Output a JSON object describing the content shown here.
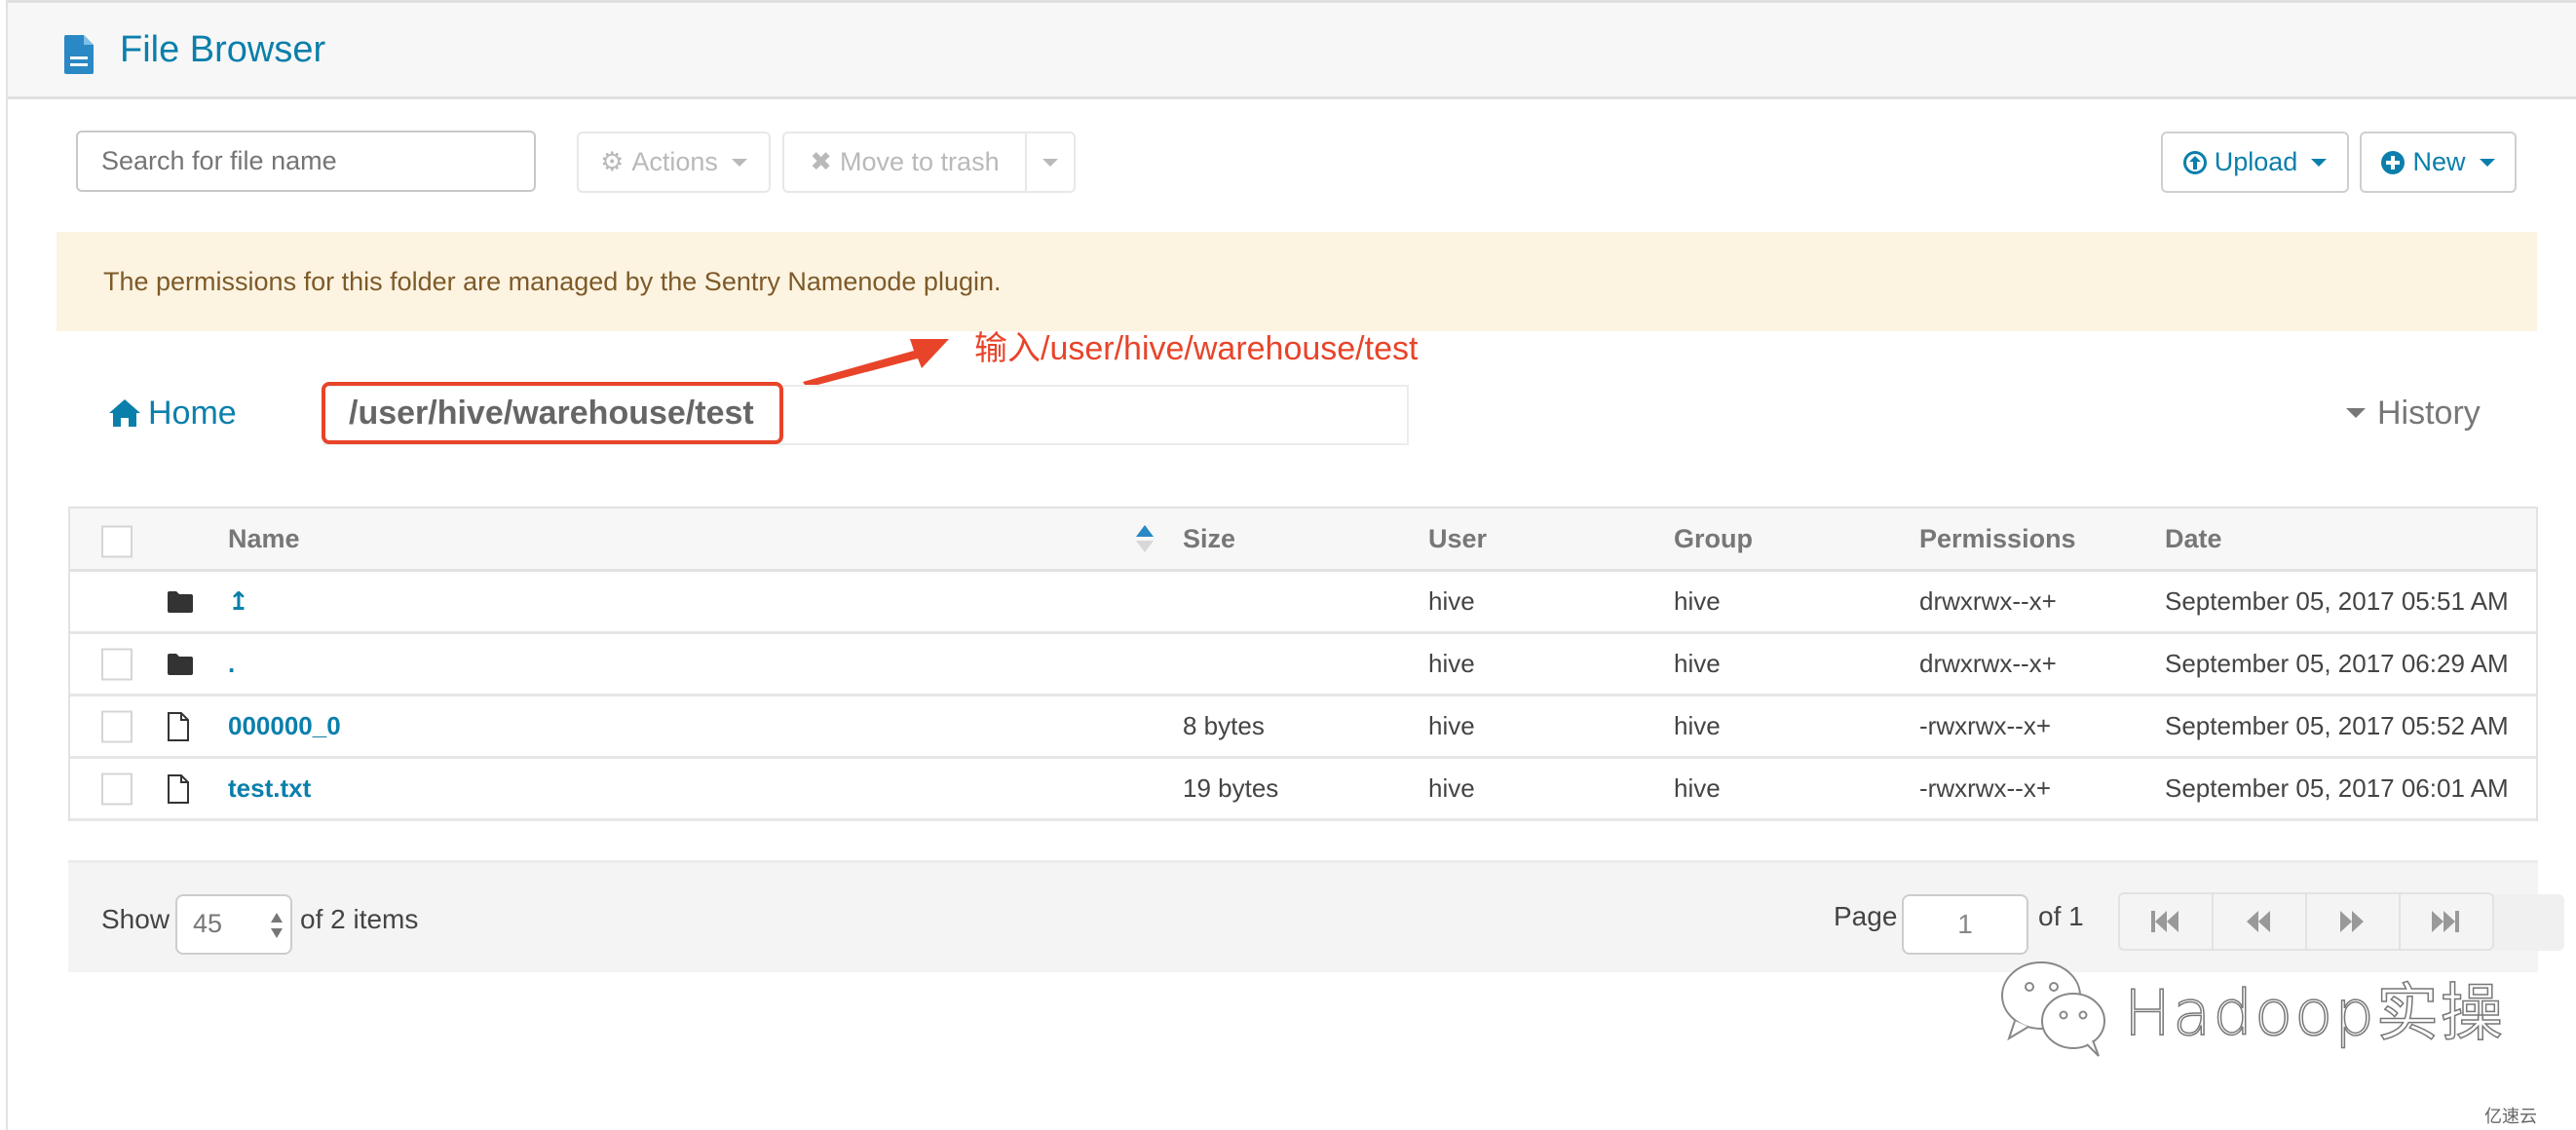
{
  "header": {
    "title": "File Browser",
    "icon": "file-text-icon"
  },
  "toolbar": {
    "search_placeholder": "Search for file name",
    "actions_label": "Actions",
    "move_to_trash_label": "Move to trash",
    "upload_label": "Upload",
    "new_label": "New"
  },
  "alert": {
    "message": "The permissions for this folder are managed by the Sentry Namenode plugin."
  },
  "annotation": {
    "text": "输入/user/hive/warehouse/test",
    "color": "#e8442a"
  },
  "path_bar": {
    "home_label": "Home",
    "path_value": "/user/hive/warehouse/test",
    "history_label": "History"
  },
  "table": {
    "columns": {
      "name": "Name",
      "size": "Size",
      "user": "User",
      "group": "Group",
      "permissions": "Permissions",
      "date": "Date"
    },
    "sort": {
      "column": "Name",
      "direction": "ascending"
    },
    "rows": [
      {
        "type": "folder",
        "name": "↥",
        "size": "",
        "user": "hive",
        "group": "hive",
        "permissions": "drwxrwx--x+",
        "date": "September 05, 2017 05:51 AM",
        "checkbox": false
      },
      {
        "type": "folder",
        "name": ".",
        "size": "",
        "user": "hive",
        "group": "hive",
        "permissions": "drwxrwx--x+",
        "date": "September 05, 2017 06:29 AM",
        "checkbox": true
      },
      {
        "type": "file",
        "name": "000000_0",
        "size": "8 bytes",
        "user": "hive",
        "group": "hive",
        "permissions": "-rwxrwx--x+",
        "date": "September 05, 2017 05:52 AM",
        "checkbox": true
      },
      {
        "type": "file",
        "name": "test.txt",
        "size": "19 bytes",
        "user": "hive",
        "group": "hive",
        "permissions": "-rwxrwx--x+",
        "date": "September 05, 2017 06:01 AM",
        "checkbox": true
      }
    ]
  },
  "footer": {
    "show_label": "Show",
    "page_size": "45",
    "items_label": "of 2 items",
    "page_label": "Page",
    "page_value": "1",
    "of_pages_label": "of 1"
  },
  "watermark": {
    "text": "Hadoop实操",
    "corner_logo": "亿速云"
  },
  "colors": {
    "brand": "#0b7fab",
    "alert_bg": "#fdf3e1",
    "alert_text": "#7d5a29",
    "annotation": "#e8442a"
  }
}
